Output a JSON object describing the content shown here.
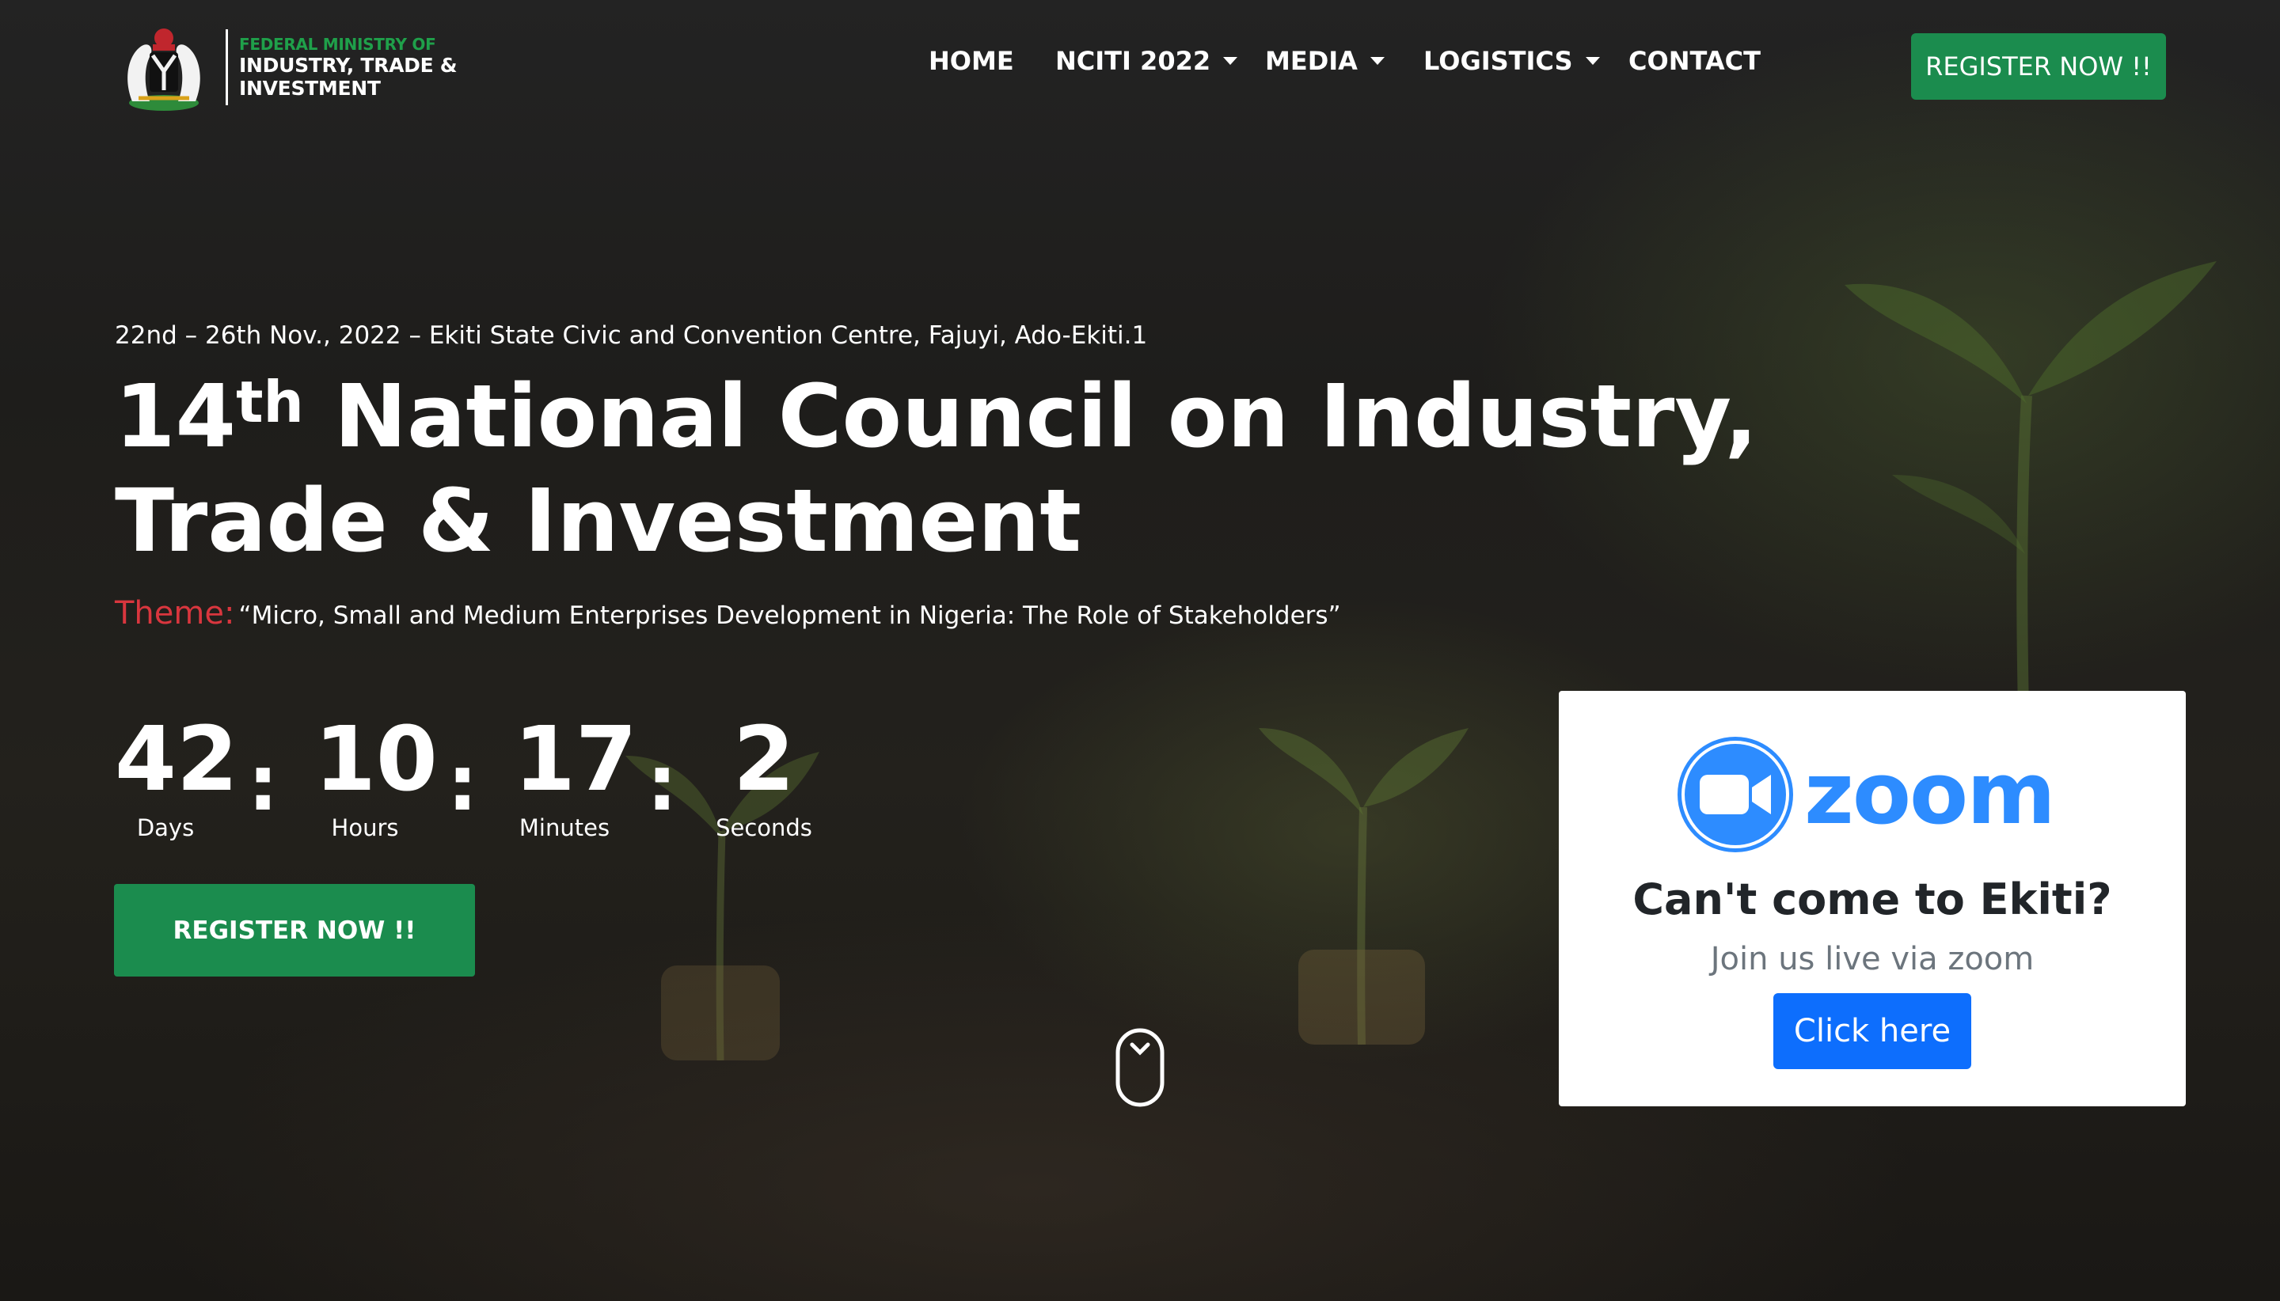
{
  "header": {
    "logo_line1": "FEDERAL MINISTRY OF",
    "logo_line2": "INDUSTRY, TRADE &",
    "logo_line3": "INVESTMENT",
    "nav": [
      {
        "label": "HOME",
        "has_dropdown": false
      },
      {
        "label": "NCITI 2022",
        "has_dropdown": true
      },
      {
        "label": "MEDIA",
        "has_dropdown": true
      },
      {
        "label": "LOGISTICS",
        "has_dropdown": true
      },
      {
        "label": "CONTACT",
        "has_dropdown": false
      }
    ],
    "register_label": "REGISTER NOW !!"
  },
  "hero": {
    "date_line": "22nd – 26th Nov., 2022 – Ekiti State Civic and Convention Centre, Fajuyi, Ado-Ekiti.1",
    "title_number": "14",
    "title_sup": "th",
    "title_rest": " National Council on Industry,",
    "title_line2": "Trade & Investment",
    "theme_label": "Theme:",
    "theme_text": "“Micro, Small and Medium Enterprises Development in Nigeria: The Role of Stakeholders”",
    "countdown": [
      {
        "value": "42",
        "label": "Days"
      },
      {
        "value": "10",
        "label": "Hours"
      },
      {
        "value": "17",
        "label": "Minutes"
      },
      {
        "value": "2",
        "label": "Seconds"
      }
    ],
    "separator": ":",
    "register_label": "REGISTER NOW !!"
  },
  "zoom_card": {
    "wordmark": "zoom",
    "title": "Can't come to Ekiti?",
    "subtitle": "Join us live via zoom",
    "button_label": "Click here"
  },
  "colors": {
    "brand_green": "#1b8c4e",
    "theme_red": "#d9363e",
    "zoom_blue": "#2d8cff",
    "button_blue": "#0d6efd"
  },
  "icons": [
    "coat-of-arms-icon",
    "caret-down-icon",
    "zoom-camera-icon",
    "scroll-mouse-icon"
  ]
}
